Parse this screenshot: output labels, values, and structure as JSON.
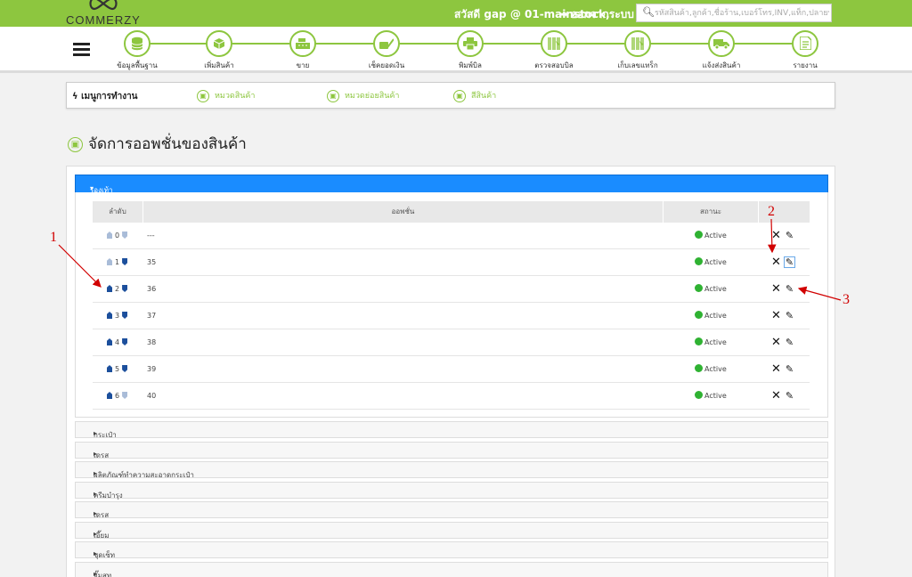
{
  "header": {
    "logo_text": "COMMERZY",
    "greeting": "สวัสดี gap @ 01-mainstock,",
    "logout_label": "ออกจากระบบ",
    "search_placeholder": "รหัสสินค้า,ลูกค้า,ชื่อร้าน,เบอร์โทร,INV,แท็ก,ปลายทาง"
  },
  "nav": {
    "items": [
      {
        "label": "ข้อมูลพื้นฐาน",
        "icon": "database-icon"
      },
      {
        "label": "เพิ่มสินค้า",
        "icon": "box-icon"
      },
      {
        "label": "ขาย",
        "icon": "cash-register-icon"
      },
      {
        "label": "เช็คยอดเงิน",
        "icon": "money-check-icon"
      },
      {
        "label": "พิมพ์บิล",
        "icon": "printer-icon"
      },
      {
        "label": "ตรวจสอบบิล",
        "icon": "barcode-scan-icon"
      },
      {
        "label": "เก็บเลขแทร็ก",
        "icon": "barcode-scan-icon"
      },
      {
        "label": "แจ้งส่งสินค้า",
        "icon": "truck-icon"
      },
      {
        "label": "รายงาน",
        "icon": "report-icon"
      }
    ]
  },
  "menu": {
    "title": "เมนูการทำงาน",
    "links": [
      {
        "label": "หมวดสินค้า"
      },
      {
        "label": "หมวดย่อยสินค้า"
      },
      {
        "label": "สีสินค้า"
      }
    ]
  },
  "page": {
    "title": "จัดการออพชั่นของสินค้า"
  },
  "open_category": {
    "label": "รองเท้า",
    "columns": [
      "ลำดับ",
      "ออพชั่น",
      "สถานะ"
    ],
    "rows": [
      {
        "order": "0",
        "option": "---",
        "status": "Active"
      },
      {
        "order": "1",
        "option": "35",
        "status": "Active"
      },
      {
        "order": "2",
        "option": "36",
        "status": "Active"
      },
      {
        "order": "3",
        "option": "37",
        "status": "Active"
      },
      {
        "order": "4",
        "option": "38",
        "status": "Active"
      },
      {
        "order": "5",
        "option": "39",
        "status": "Active"
      },
      {
        "order": "6",
        "option": "40",
        "status": "Active"
      }
    ]
  },
  "categories": [
    {
      "label": "กระเป๋า"
    },
    {
      "label": "เดรส"
    },
    {
      "label": "ผลิตภัณฑ์ทำความสะอาดกระเป๋า"
    },
    {
      "label": "ครีมบำรุง"
    },
    {
      "label": "เดรส"
    },
    {
      "label": "เอี๊ยม"
    },
    {
      "label": "ชุดเซ็ท"
    },
    {
      "label": "จั๊มสูท"
    }
  ],
  "annotations": {
    "labels": [
      "1",
      "2",
      "3"
    ],
    "color": "#d10000"
  },
  "colors": {
    "brand_green": "#8dc63f",
    "header_blue": "#1a8cff",
    "active_green": "#2fb232"
  }
}
